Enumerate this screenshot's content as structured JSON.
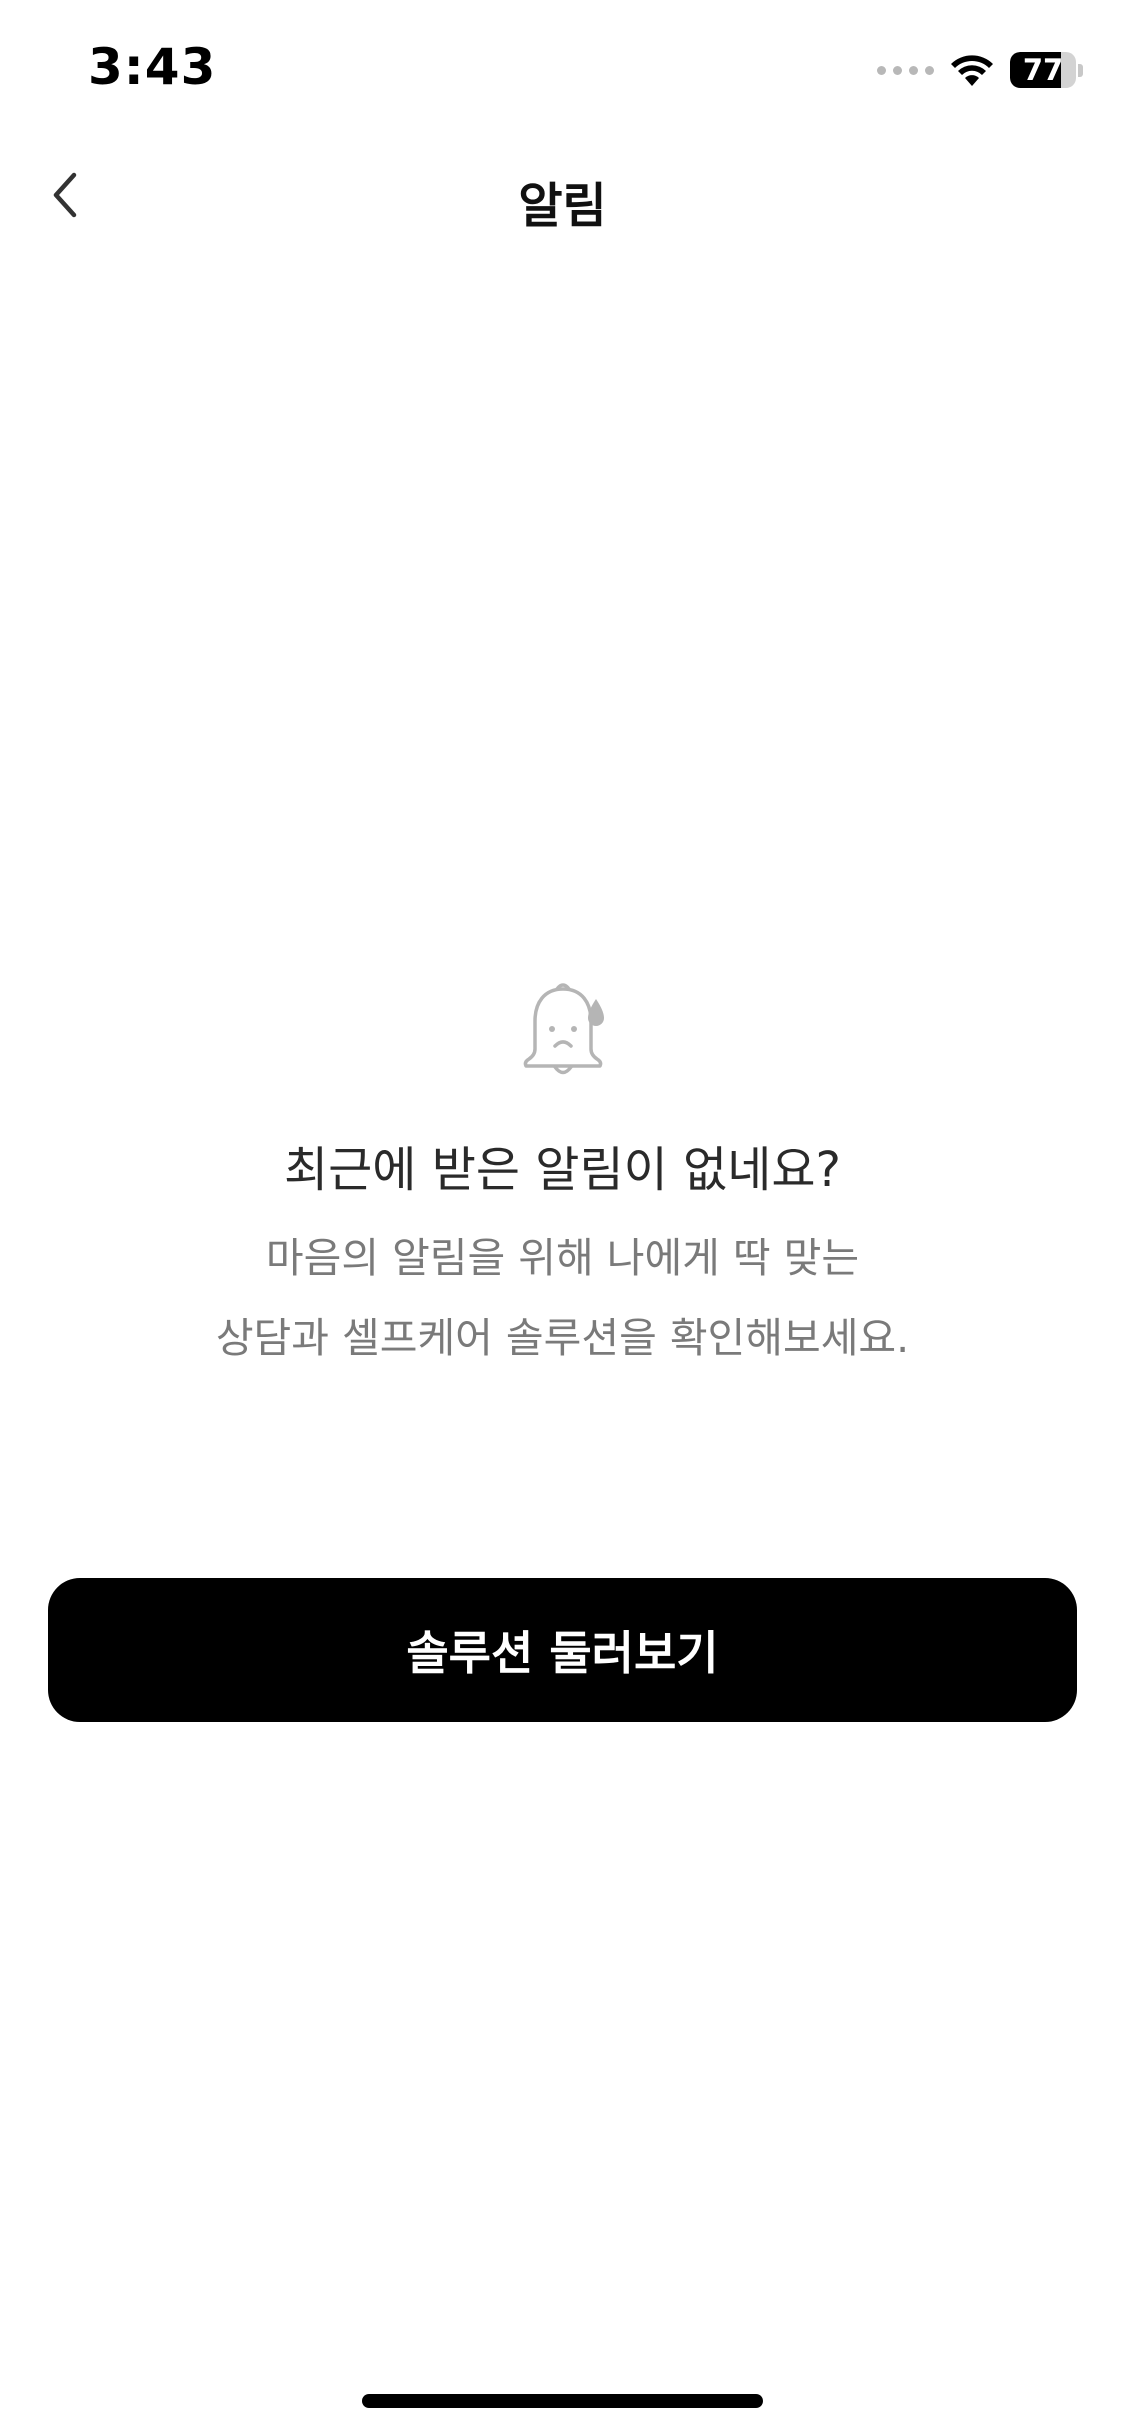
{
  "status_bar": {
    "time": "3:43",
    "battery_level": "77",
    "battery_fraction": 0.77,
    "icons": [
      "cellular-signal-icon",
      "wifi-icon",
      "battery-icon"
    ]
  },
  "nav": {
    "title": "알림",
    "back_icon": "chevron-left-icon"
  },
  "empty_state": {
    "icon": "sad-bell-icon",
    "title": "최근에 받은 알림이 없네요?",
    "description_line1": "마음의 알림을 위해 나에게 딱 맞는",
    "description_line2": "상담과 셀프케어 솔루션을 확인해보세요."
  },
  "primary_button": {
    "label": "솔루션 둘러보기"
  },
  "colors": {
    "background": "#ffffff",
    "button_bg": "#000000",
    "button_text": "#ffffff",
    "title_text": "#2a2a2a",
    "description_text": "#7a7a7a",
    "icon_gray": "#b5b5b5"
  }
}
